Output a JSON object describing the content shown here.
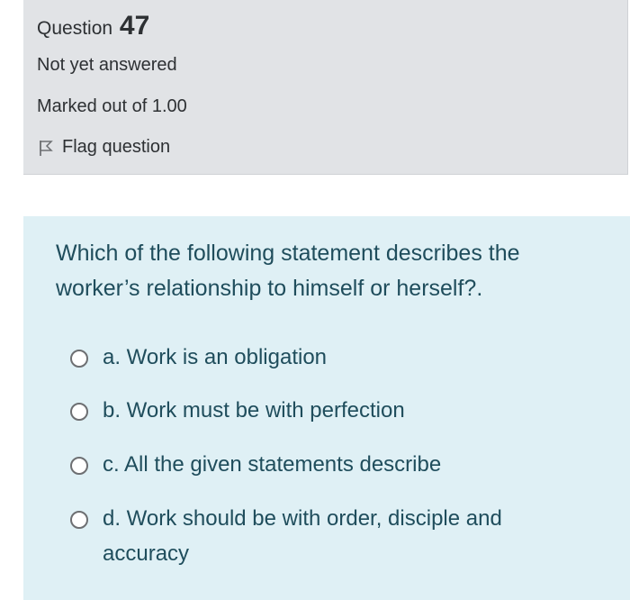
{
  "question_info": {
    "label": "Question",
    "number": "47",
    "state": "Not yet answered",
    "grade": "Marked out of 1.00",
    "flag_label": "Flag question",
    "flag_icon": "flag-outline-icon"
  },
  "question": {
    "text": "Which of the following statement describes the worker’s relationship to himself or herself?.",
    "options": [
      {
        "label": "a. Work is an obligation",
        "selected": false
      },
      {
        "label": "b. Work must be with perfection",
        "selected": false
      },
      {
        "label": "c. All the given statements describe",
        "selected": false
      },
      {
        "label": "d. Work should be with order, disciple and accuracy",
        "selected": false
      }
    ]
  },
  "colors": {
    "info_background": "#e1e3e6",
    "content_background": "#dff0f5",
    "question_text": "#1f4d5c",
    "info_text": "#2d3033"
  }
}
